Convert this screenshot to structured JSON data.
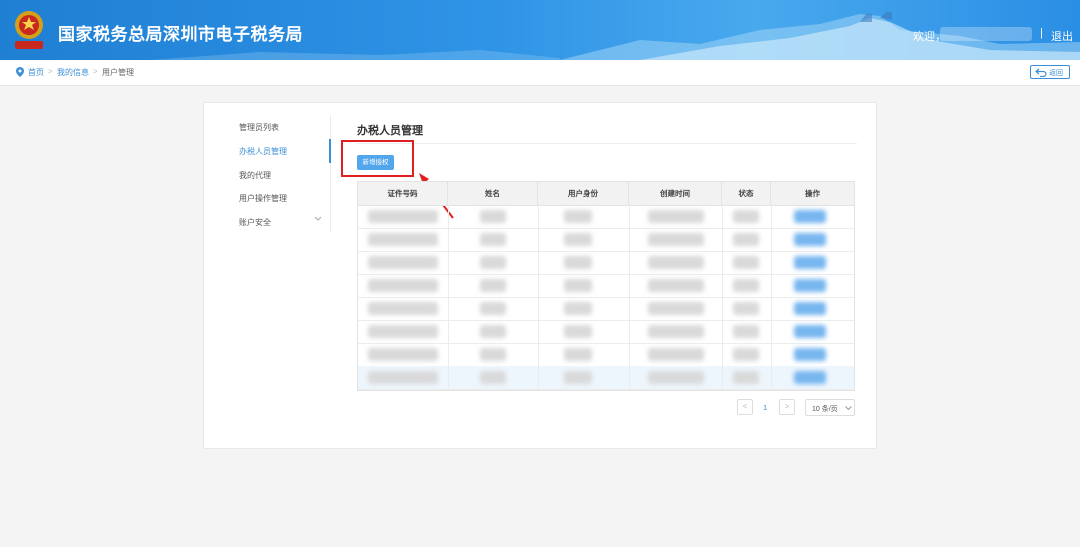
{
  "header": {
    "title": "国家税务总局深圳市电子税务局",
    "welcome": "欢迎，",
    "separator": "|",
    "logout": "退出"
  },
  "breadcrumb": {
    "items": [
      "首页",
      "我的信息",
      "用户管理"
    ],
    "separator": ">",
    "back_label": "返回"
  },
  "sidebar": {
    "items": [
      {
        "label": "管理员列表"
      },
      {
        "label": "办税人员管理",
        "active": true
      },
      {
        "label": "我的代理"
      },
      {
        "label": "用户操作管理"
      },
      {
        "label": "账户安全"
      }
    ]
  },
  "main": {
    "title": "办税人员管理",
    "add_button": "新增授权"
  },
  "table": {
    "columns": [
      "证件号码",
      "姓名",
      "用户身份",
      "创建时间",
      "状态",
      "操作"
    ],
    "row_count": 8
  },
  "pagination": {
    "prev": "<",
    "page": "1",
    "next": ">",
    "page_size": "10 条/页"
  },
  "colors": {
    "header_blue": "#2f93e6",
    "accent": "#3b8fd6",
    "highlight_red": "#e02020"
  }
}
